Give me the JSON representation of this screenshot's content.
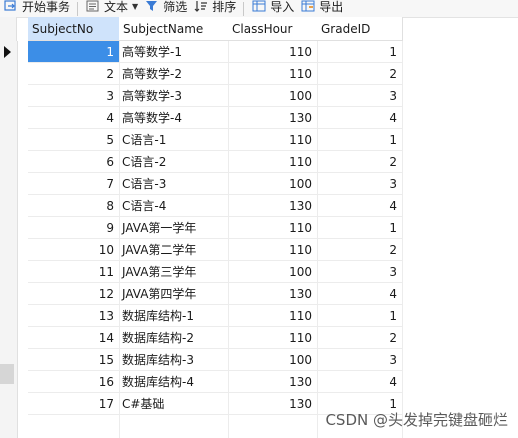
{
  "toolbar": {
    "begin_txn": "开始事务",
    "text": "文本",
    "filter": "筛选",
    "sort": "排序",
    "import": "导入",
    "export": "导出"
  },
  "columns": [
    "SubjectNo",
    "SubjectName",
    "ClassHour",
    "GradeID"
  ],
  "rows": [
    [
      "1",
      "高等数学-1",
      "110",
      "1"
    ],
    [
      "2",
      "高等数学-2",
      "110",
      "2"
    ],
    [
      "3",
      "高等数学-3",
      "100",
      "3"
    ],
    [
      "4",
      "高等数学-4",
      "130",
      "4"
    ],
    [
      "5",
      "C语言-1",
      "110",
      "1"
    ],
    [
      "6",
      "C语言-2",
      "110",
      "2"
    ],
    [
      "7",
      "C语言-3",
      "100",
      "3"
    ],
    [
      "8",
      "C语言-4",
      "130",
      "4"
    ],
    [
      "9",
      "JAVA第一学年",
      "110",
      "1"
    ],
    [
      "10",
      "JAVA第二学年",
      "110",
      "2"
    ],
    [
      "11",
      "JAVA第三学年",
      "100",
      "3"
    ],
    [
      "12",
      "JAVA第四学年",
      "130",
      "4"
    ],
    [
      "13",
      "数据库结构-1",
      "110",
      "1"
    ],
    [
      "14",
      "数据库结构-2",
      "110",
      "2"
    ],
    [
      "15",
      "数据库结构-3",
      "100",
      "3"
    ],
    [
      "16",
      "数据库结构-4",
      "130",
      "4"
    ],
    [
      "17",
      "C#基础",
      "130",
      "1"
    ]
  ],
  "watermark": "CSDN @头发掉完键盘砸烂",
  "colors": {
    "selected_cell": "#3c8ee7",
    "selected_header": "#cfe3fb"
  }
}
